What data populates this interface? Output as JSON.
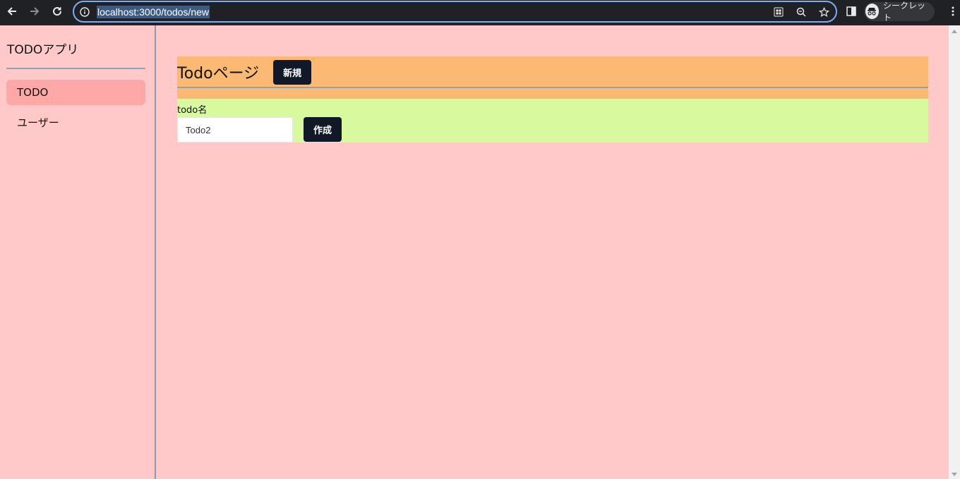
{
  "browser": {
    "url": "localhost:3000/todos/new",
    "profile_label": "シークレット",
    "icons": {
      "back": "back-arrow-icon",
      "forward": "forward-arrow-icon",
      "reload": "reload-icon",
      "info": "info-icon",
      "apps": "app-grid-icon",
      "zoom": "zoom-icon",
      "bookmark": "star-icon",
      "sidepanel": "side-panel-icon",
      "incognito": "incognito-icon",
      "menu": "kebab-menu-icon"
    }
  },
  "sidebar": {
    "app_title": "TODOアプリ",
    "items": [
      {
        "label": "TODO",
        "active": true
      },
      {
        "label": "ユーザー",
        "active": false
      }
    ]
  },
  "main": {
    "page_title": "Todoページ",
    "new_button": "新規",
    "form": {
      "label": "todo名",
      "input_value": "Todo2",
      "submit_button": "作成"
    }
  },
  "colors": {
    "page_bg": "#ffc9c9",
    "active_nav": "#ffa8a8",
    "header_bg": "#fcb974",
    "form_bg": "#d8f99d",
    "button_bg": "#111827"
  }
}
